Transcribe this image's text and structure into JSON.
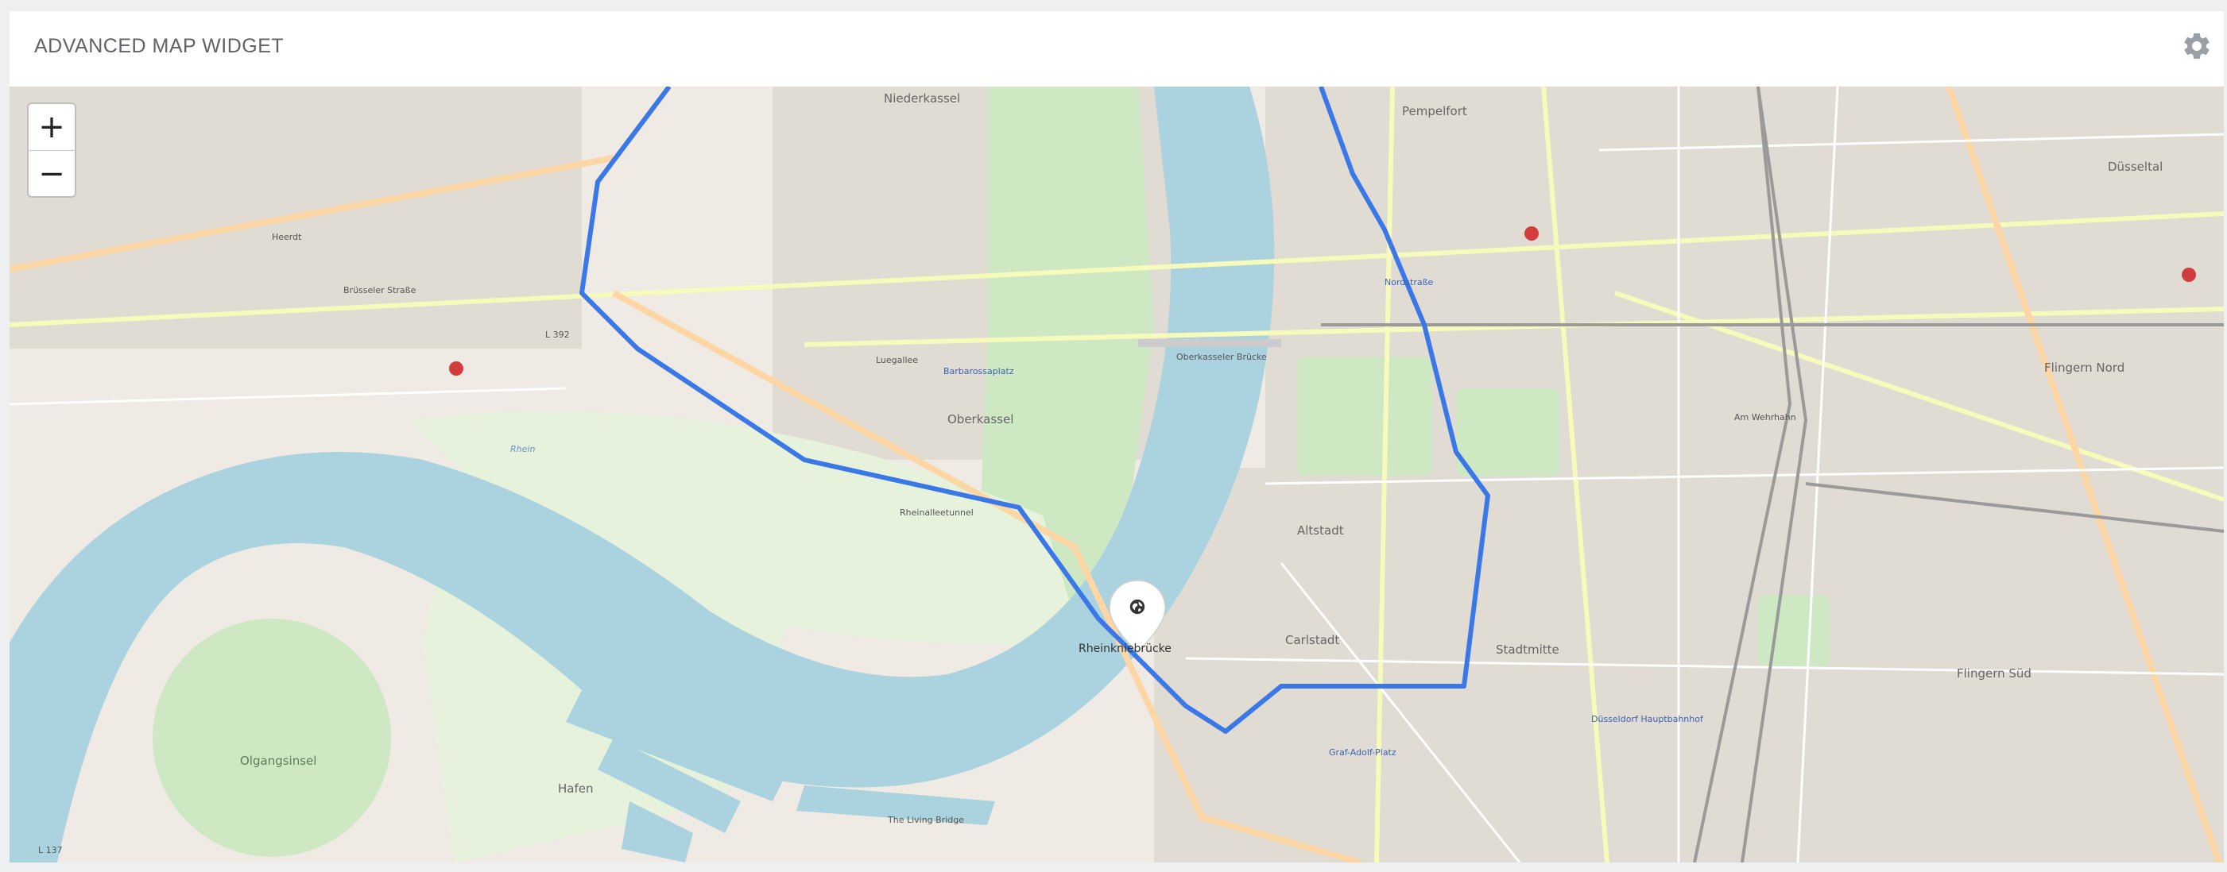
{
  "widget": {
    "title": "ADVANCED MAP WIDGET",
    "settings_icon": "gear-icon"
  },
  "map": {
    "zoom_in": "+",
    "zoom_out": "−",
    "marker": {
      "icon": "globe-icon",
      "label": "Rheinkniebrücke"
    },
    "route_color": "#3b78e7",
    "labels": {
      "niederkassel": "Niederkassel",
      "pempelfort": "Pempelfort",
      "dusseltal": "Düsseltal",
      "heerdt": "Heerdt",
      "oberkassel": "Oberkassel",
      "altstadt": "Altstadt",
      "carlstadt": "Carlstadt",
      "stadtmitte": "Stadtmitte",
      "flingern_nord": "Flingern Nord",
      "flingern_sud": "Flingern Süd",
      "hafen": "Hafen",
      "olgangsinsel": "Olgangsinsel",
      "oberkasseler_brucke": "Oberkasseler Brücke",
      "nordstrasse": "Nordstraße",
      "am_wehrhahn": "Am Wehrhahn",
      "brusseler_strasse": "Brüsseler Straße",
      "luegallee": "Luegallee",
      "barbarossaplatz": "Barbarossaplatz",
      "rheinalleetunnel": "Rheinalleetunnel",
      "rhein": "Rhein",
      "dusseldorf_hbf": "Düsseldorf Hauptbahnhof",
      "graf_adolf_platz": "Graf-Adolf-Platz",
      "the_living_bridge": "The Living Bridge",
      "l392": "L 392",
      "l137": "L 137"
    }
  }
}
